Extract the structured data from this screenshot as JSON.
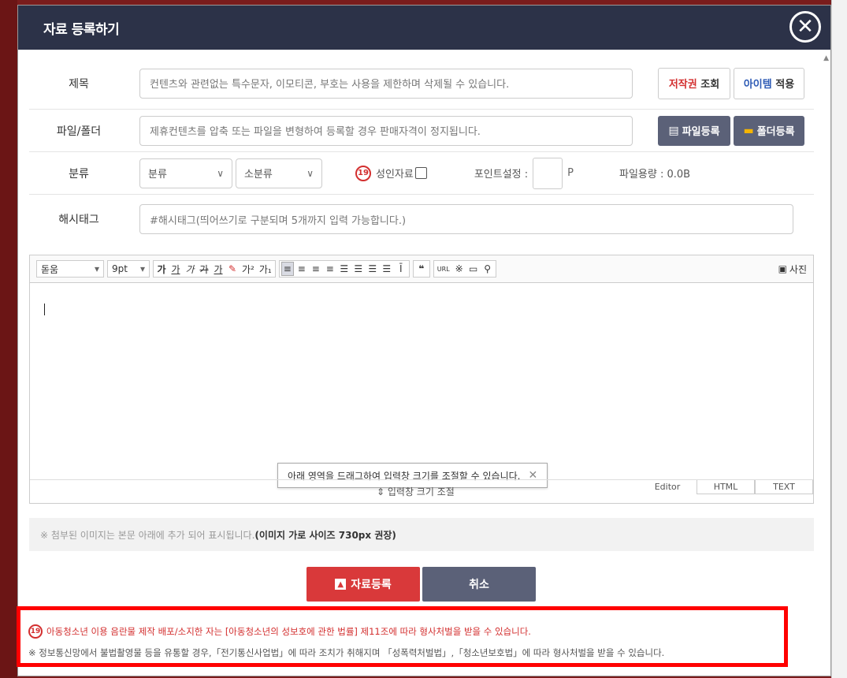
{
  "modal": {
    "title": "자료 등록하기",
    "close_icon": "close-icon"
  },
  "form": {
    "title_label": "제목",
    "title_placeholder": "컨텐츠와 관련없는 특수문자, 이모티콘, 부호는 사용을 제한하며 삭제될 수 있습니다.",
    "copyright_check": {
      "red": "저작권",
      "rest": "조회"
    },
    "item_apply": {
      "blue": "아이템",
      "rest": "적용"
    },
    "file_label": "파일/폴더",
    "file_placeholder": "제휴컨텐츠를 압축 또는 파일을 변형하여 등록할 경우 판매자격이 정지됩니다.",
    "file_register": "파일등록",
    "folder_register": "폴더등록",
    "category_label": "분류",
    "category_select": "분류",
    "subcategory_select": "소분류",
    "adult_badge": "19",
    "adult_label": "성인자료",
    "point_label": "포인트설정 :",
    "point_unit": "P",
    "file_size": "파일용량 : 0.0B",
    "hashtag_label": "해시태그",
    "hashtag_placeholder": "#해시태그(띄어쓰기로 구분되며 5개까지 입력 가능합니다.)"
  },
  "editor": {
    "font": "돋움",
    "size": "9pt",
    "buttons": [
      "가",
      "가",
      "가",
      "가",
      "가",
      "가",
      "가²",
      "가₁"
    ],
    "align_buttons": [
      "≡",
      "≡",
      "≡",
      "≡",
      "☰",
      "☰",
      "☰",
      "☰",
      "Ī"
    ],
    "quote": "❝",
    "url": "URL",
    "special": "※",
    "photo": "사진",
    "tooltip": "아래 영역을 드래그하여 입력창 크기를 조절할 수 있습니다.",
    "resize_label": "⇕ 입력창 크기 조절",
    "modes": [
      "Editor",
      "HTML",
      "TEXT"
    ]
  },
  "notice": {
    "text": "※ 첨부된 이미지는 본문 아래에 추가 되어 표시됩니다.",
    "bold": "(이미지 가로 사이즈 730px 권장)"
  },
  "actions": {
    "submit": "자료등록",
    "cancel": "취소"
  },
  "warning": {
    "badge": "19",
    "line1": "아동청소년 이용 음란물 제작 배포/소지한 자는 [아동청소년의 성보호에 관한 법률] 제11조에 따라 형사처벌을 받을 수 있습니다.",
    "line2": "※ 정보통신망에서 불법촬영물 등을 유통할 경우,「전기통신사업법」에 따라 조치가 취해지며 「성폭력처벌법」,「청소년보호법」에 따라 형사처벌을 받을 수 있습니다."
  }
}
